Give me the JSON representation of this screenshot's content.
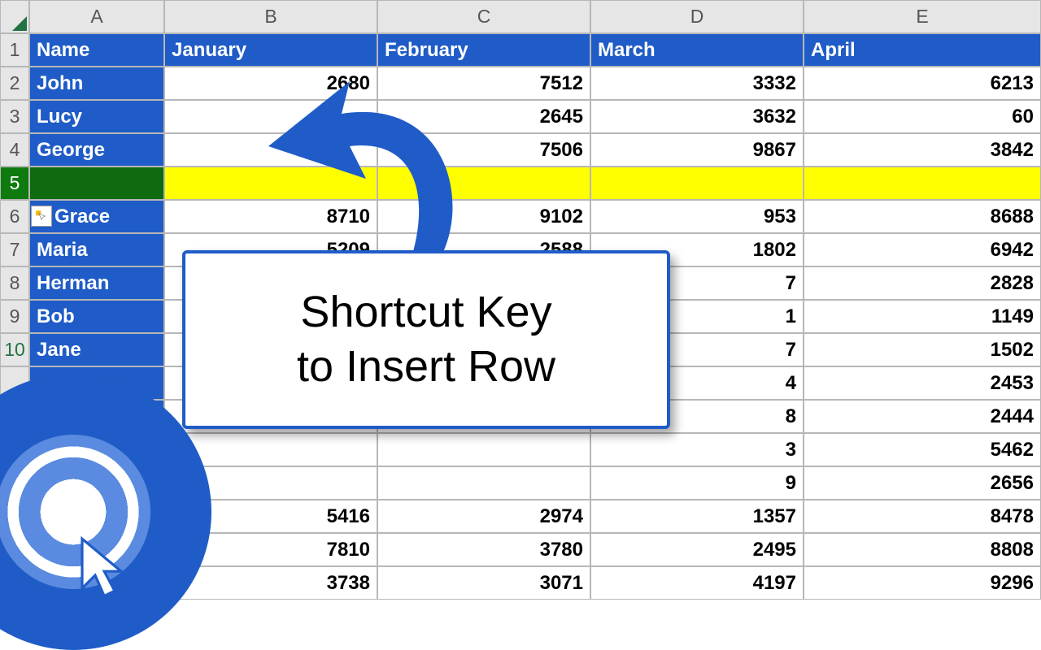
{
  "columns": [
    "A",
    "B",
    "C",
    "D",
    "E"
  ],
  "row_numbers": [
    "1",
    "2",
    "3",
    "4",
    "5",
    "6",
    "7",
    "8",
    "9",
    "10",
    "",
    "",
    "",
    "",
    "",
    "",
    ""
  ],
  "headers": {
    "A": "Name",
    "B": "January",
    "C": "February",
    "D": "March",
    "E": "April"
  },
  "rows": [
    {
      "name": "John",
      "jan": "2680",
      "feb": "7512",
      "mar": "3332",
      "apr": "6213"
    },
    {
      "name": "Lucy",
      "jan": "",
      "feb": "2645",
      "mar": "3632",
      "apr": "60"
    },
    {
      "name": "George",
      "jan": "",
      "feb": "7506",
      "mar": "9867",
      "apr": "3842"
    },
    {
      "name": "",
      "jan": "",
      "feb": "",
      "mar": "",
      "apr": "",
      "inserted": true
    },
    {
      "name": "Grace",
      "jan": "8710",
      "feb": "9102",
      "mar": "953",
      "apr": "8688",
      "partial_cover": true
    },
    {
      "name": "Maria",
      "jan": "5209",
      "feb": "2588",
      "mar": "1802",
      "apr": "6942"
    },
    {
      "name": "Herman",
      "jan": "",
      "feb": "",
      "mar_tail": "7",
      "apr": "2828"
    },
    {
      "name": "Bob",
      "jan": "",
      "feb": "",
      "mar_tail": "1",
      "apr": "1149"
    },
    {
      "name": "Jane",
      "jan": "",
      "feb": "",
      "mar_tail": "7",
      "apr": "1502"
    },
    {
      "name": "",
      "jan": "",
      "feb": "",
      "mar_tail": "4",
      "apr": "2453"
    },
    {
      "name": "",
      "jan": "",
      "feb": "",
      "mar_tail": "8",
      "apr": "2444"
    },
    {
      "name": "",
      "jan": "",
      "feb": "",
      "mar_tail": "3",
      "apr": "5462"
    },
    {
      "name": "",
      "jan": "",
      "feb": "",
      "mar_tail": "9",
      "apr": "2656"
    },
    {
      "name": "",
      "jan": "5416",
      "feb": "2974",
      "mar": "1357",
      "apr": "8478"
    },
    {
      "name": "",
      "jan": "7810",
      "feb": "3780",
      "mar": "2495",
      "apr": "8808"
    },
    {
      "name": "",
      "jan": "3738",
      "feb": "3071",
      "mar": "4197",
      "apr": "9296"
    }
  ],
  "callout": {
    "line1": "Shortcut Key",
    "line2": "to Insert Row"
  },
  "colors": {
    "header_blue": "#1f5cc7",
    "highlight_yellow": "#ffff00",
    "excel_green": "#217346"
  }
}
